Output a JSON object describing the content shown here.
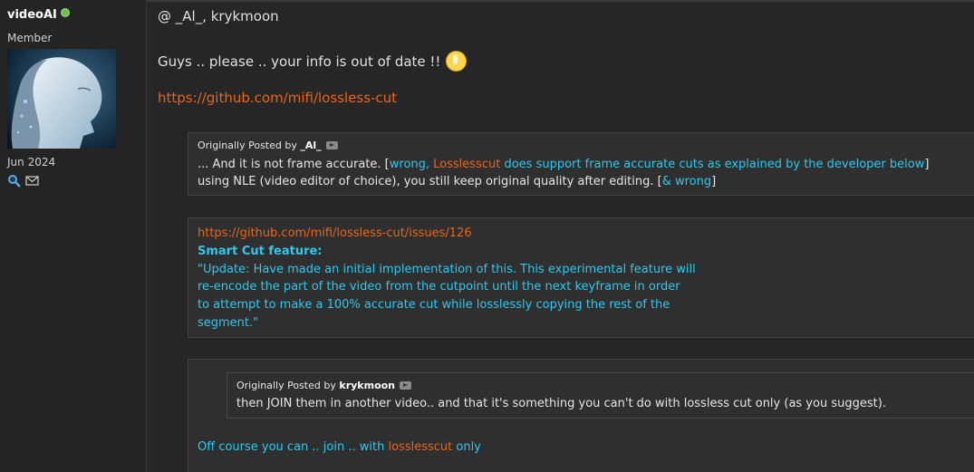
{
  "sidebar": {
    "username": "videoAI",
    "role": "Member",
    "join_date": "Jun 2024",
    "avatar_alt": "avatar",
    "icons": [
      "search-icon",
      "envelope-icon"
    ]
  },
  "post": {
    "mention": "@ _Al_, krykmoon",
    "intro": "Guys .. please .. your info is out of date !!",
    "link": "https://github.com/mifi/lossless-cut",
    "quote1": {
      "prefix": "Originally Posted by",
      "author": "_Al_",
      "line1_a": "... And it is not frame accurate. [",
      "line1_b": "wrong, ",
      "line1_c": "Losslesscut",
      "line1_d": " does support frame accurate cuts as explained by the developer below",
      "line1_e": "]",
      "line2_a": "using NLE (video editor of choice), you still keep original quality after editing. [",
      "line2_b": "& wrong",
      "line2_c": "]"
    },
    "quote2": {
      "link": "https://github.com/mifi/lossless-cut/issues/126",
      "heading": "Smart Cut feature:",
      "lines": [
        "\"Update: Have made an initial implementation of this. This experimental feature will",
        "re-encode the part of the video from the cutpoint until the next keyframe in order",
        "to attempt to make a 100% accurate cut while losslessly copying the rest of the",
        "segment.\""
      ]
    },
    "quote3": {
      "prefix": "Originally Posted by",
      "author": "krykmoon",
      "text": "then JOIN them in another video.. and that it's something you can't do with lossless cut only (as you suggest).",
      "reply_a": "Off course you can .. join .. with ",
      "reply_b": "losslesscut",
      "reply_c": " only"
    }
  },
  "colors": {
    "accent_cyan": "#2fc8ee",
    "link_orange": "#e7661c",
    "online_green": "#6fbf4a"
  }
}
